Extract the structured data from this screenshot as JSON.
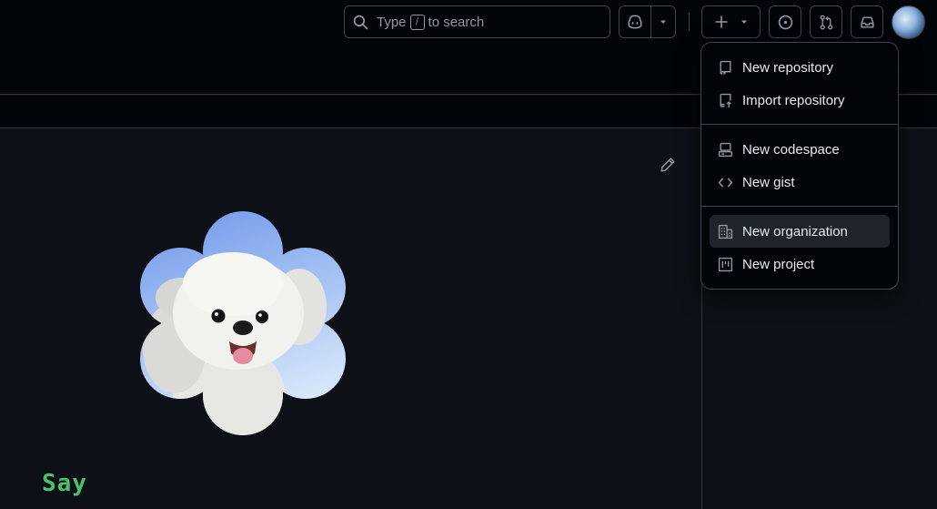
{
  "search": {
    "prefix": "Type",
    "key": "/",
    "suffix": "to search"
  },
  "create_menu": {
    "items": [
      {
        "label": "New repository",
        "icon": "repo-icon"
      },
      {
        "label": "Import repository",
        "icon": "repo-push-icon"
      },
      {
        "label": "New codespace",
        "icon": "codespaces-icon"
      },
      {
        "label": "New gist",
        "icon": "code-icon"
      },
      {
        "label": "New organization",
        "icon": "organization-icon",
        "active": true
      },
      {
        "label": "New project",
        "icon": "project-icon"
      }
    ]
  },
  "profile": {
    "bio_text": "Say"
  },
  "colors": {
    "accent_green": "#4ac26b",
    "background": "#0d1117",
    "header": "#010409",
    "border": "#30363d"
  }
}
